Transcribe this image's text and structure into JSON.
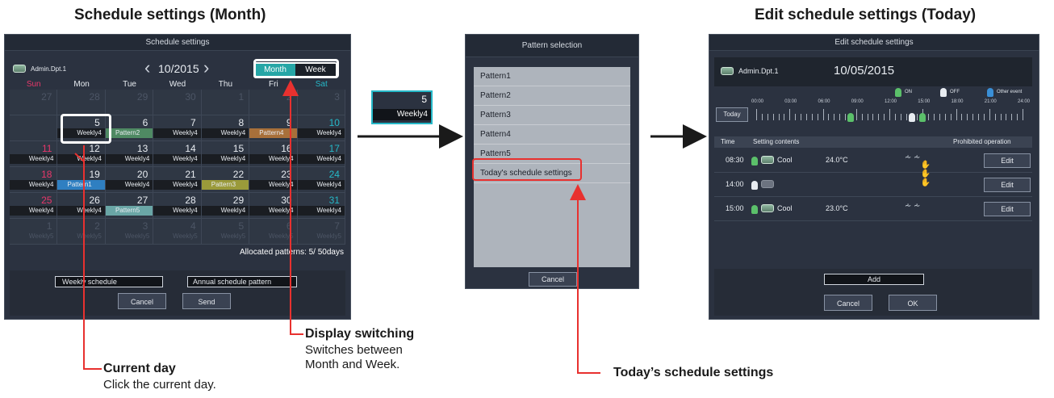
{
  "headings": {
    "month": "Schedule settings (Month)",
    "edit": "Edit schedule settings (Today)"
  },
  "calendar": {
    "title": "Schedule settings",
    "group": "Admin.Dpt.1",
    "month_label": "10/2015",
    "prev_icon": "‹",
    "next_icon": "›",
    "view_month": "Month",
    "view_week": "Week",
    "days": [
      "Sun",
      "Mon",
      "Tue",
      "Wed",
      "Thu",
      "Fri",
      "Sat"
    ],
    "weeks": [
      [
        {
          "n": "27",
          "p": "",
          "dim": true
        },
        {
          "n": "28",
          "p": "",
          "dim": true
        },
        {
          "n": "29",
          "p": "",
          "dim": true
        },
        {
          "n": "30",
          "p": "",
          "dim": true
        },
        {
          "n": "1",
          "p": "",
          "dim": true
        },
        {
          "n": "2",
          "p": "",
          "dim": true
        },
        {
          "n": "3",
          "p": "",
          "dim": true
        }
      ],
      [
        {
          "n": "",
          "p": ""
        },
        {
          "n": "5",
          "p": "Weekly4"
        },
        {
          "n": "6",
          "p": "Pattern2"
        },
        {
          "n": "7",
          "p": "Weekly4"
        },
        {
          "n": "8",
          "p": "Weekly4"
        },
        {
          "n": "9",
          "p": "Pattern4"
        },
        {
          "n": "10",
          "p": "Weekly4"
        }
      ],
      [
        {
          "n": "11",
          "p": "Weekly4"
        },
        {
          "n": "12",
          "p": "Weekly4"
        },
        {
          "n": "13",
          "p": "Weekly4"
        },
        {
          "n": "14",
          "p": "Weekly4"
        },
        {
          "n": "15",
          "p": "Weekly4"
        },
        {
          "n": "16",
          "p": "Weekly4"
        },
        {
          "n": "17",
          "p": "Weekly4"
        }
      ],
      [
        {
          "n": "18",
          "p": "Weekly4"
        },
        {
          "n": "19",
          "p": "Pattern1"
        },
        {
          "n": "20",
          "p": "Weekly4"
        },
        {
          "n": "21",
          "p": "Weekly4"
        },
        {
          "n": "22",
          "p": "Pattern3"
        },
        {
          "n": "23",
          "p": "Weekly4"
        },
        {
          "n": "24",
          "p": "Weekly4"
        }
      ],
      [
        {
          "n": "25",
          "p": "Weekly4"
        },
        {
          "n": "26",
          "p": "Weekly4"
        },
        {
          "n": "27",
          "p": "Pattern5"
        },
        {
          "n": "28",
          "p": "Weekly4"
        },
        {
          "n": "29",
          "p": "Weekly4"
        },
        {
          "n": "30",
          "p": "Weekly4"
        },
        {
          "n": "31",
          "p": "Weekly4"
        }
      ],
      [
        {
          "n": "1",
          "p": "Weekly5",
          "dim": true
        },
        {
          "n": "2",
          "p": "Weekly5",
          "dim": true
        },
        {
          "n": "3",
          "p": "Weekly5",
          "dim": true
        },
        {
          "n": "4",
          "p": "Weekly5",
          "dim": true
        },
        {
          "n": "5",
          "p": "Weekly5",
          "dim": true
        },
        {
          "n": "6",
          "p": "Weekly5",
          "dim": true
        },
        {
          "n": "7",
          "p": "Weekly5",
          "dim": true
        }
      ]
    ],
    "allocated": "Allocated patterns: 5/ 50days",
    "weekly_btn": "Weekly schedule",
    "annual_btn": "Annual schedule pattern",
    "cancel": "Cancel",
    "send": "Send",
    "colors": {
      "sun": "#e8376a",
      "sat": "#25b8c8",
      "pattern1": "#2f7fc1",
      "pattern2": "#4f8a63",
      "pattern3": "#9a9a3a",
      "pattern4": "#a8703a",
      "pattern5": "#6aa6a6"
    }
  },
  "zoom": {
    "day": "5",
    "pattern": "Weekly4"
  },
  "pattern_dialog": {
    "title": "Pattern selection",
    "items": [
      "Pattern1",
      "Pattern2",
      "Pattern3",
      "Pattern4",
      "Pattern5",
      "Today's schedule settings"
    ],
    "cancel": "Cancel"
  },
  "edit": {
    "title": "Edit schedule settings",
    "group": "Admin.Dpt.1",
    "date": "10/05/2015",
    "legend_on": "ON",
    "legend_off": "OFF",
    "legend_other": "Other event",
    "today": "Today",
    "times": [
      "00:00",
      "03:00",
      "06:00",
      "09:00",
      "12:00",
      "15:00",
      "18:00",
      "21:00",
      "24:00"
    ],
    "col_time": "Time",
    "col_setting": "Setting contents",
    "col_prohibited": "Prohibited operation",
    "rows": [
      {
        "time": "08:30",
        "mode": "Cool",
        "temp": "24.0°C",
        "edit": "Edit"
      },
      {
        "time": "14:00",
        "mode": "",
        "temp": "",
        "edit": "Edit"
      },
      {
        "time": "15:00",
        "mode": "Cool",
        "temp": "23.0°C",
        "edit": "Edit"
      }
    ],
    "add": "Add",
    "cancel": "Cancel",
    "ok": "OK"
  },
  "notes": {
    "current_title": "Current day",
    "current_body": "Click the current day.",
    "display_title": "Display switching",
    "display_body_1": "Switches between",
    "display_body_2": "Month and Week.",
    "today_title": "Today’s schedule settings"
  }
}
